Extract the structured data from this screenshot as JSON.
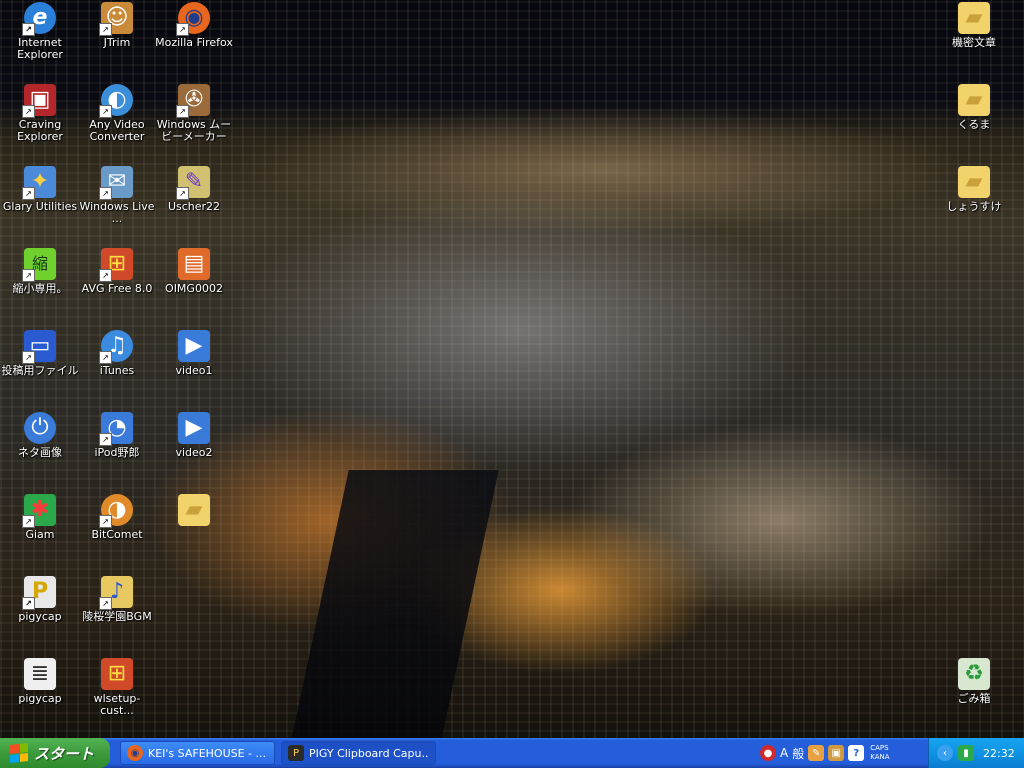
{
  "desktop_icons": [
    {
      "label": "Internet Explorer",
      "icon": "internet-explorer-icon",
      "shortcut": true,
      "color": "#2a7fd9",
      "glyph": "e"
    },
    {
      "label": "JTrim",
      "icon": "jtrim-icon",
      "shortcut": true,
      "color": "#c98a3a",
      "glyph": "☺"
    },
    {
      "label": "Mozilla Firefox",
      "icon": "firefox-icon",
      "shortcut": true,
      "color": "#e8661e",
      "glyph": "◉"
    },
    {
      "label": "Craving Explorer",
      "icon": "craving-explorer-icon",
      "shortcut": true,
      "color": "#b3262a",
      "glyph": "▣"
    },
    {
      "label": "Any Video Converter",
      "icon": "video-converter-icon",
      "shortcut": true,
      "color": "#3a8fd8",
      "glyph": "◐"
    },
    {
      "label": "Windows ムービーメーカー",
      "icon": "movie-maker-icon",
      "shortcut": true,
      "color": "#9a6a3a",
      "glyph": "✇"
    },
    {
      "label": "Glary Utilities",
      "icon": "glary-utilities-icon",
      "shortcut": true,
      "color": "#4a8ad8",
      "glyph": "✦"
    },
    {
      "label": "Windows Live ...",
      "icon": "windows-live-icon",
      "shortcut": true,
      "color": "#6a9ac8",
      "glyph": "✉"
    },
    {
      "label": "Uscher22",
      "icon": "uscher-icon",
      "shortcut": true,
      "color": "#d0c070",
      "glyph": "✎"
    },
    {
      "label": "縮小専用。",
      "icon": "shukushou-icon",
      "shortcut": true,
      "color": "#6fd02e",
      "glyph": "縮"
    },
    {
      "label": "AVG Free 8.0",
      "icon": "avg-icon",
      "shortcut": true,
      "color": "#d04a2a",
      "glyph": "⊞"
    },
    {
      "label": "OIMG0002",
      "icon": "image-file-icon",
      "shortcut": false,
      "color": "#e06a2a",
      "glyph": "▤"
    },
    {
      "label": "投稿用ファイル",
      "icon": "folder-app-icon",
      "shortcut": true,
      "color": "#2a5ad0",
      "glyph": "▭"
    },
    {
      "label": "iTunes",
      "icon": "itunes-icon",
      "shortcut": true,
      "color": "#3a8ae0",
      "glyph": "♫"
    },
    {
      "label": "video1",
      "icon": "video-file-icon",
      "shortcut": false,
      "color": "#3a7ad8",
      "glyph": "▶"
    },
    {
      "label": "ネタ画像",
      "icon": "power-icon",
      "shortcut": false,
      "color": "#3a7ad8",
      "glyph": "⏻"
    },
    {
      "label": "iPod野郎",
      "icon": "ipod-icon",
      "shortcut": true,
      "color": "#3a7ad8",
      "glyph": "◔"
    },
    {
      "label": "video2",
      "icon": "video-file-icon",
      "shortcut": false,
      "color": "#3a7ad8",
      "glyph": "▶"
    },
    {
      "label": "Giam",
      "icon": "giam-icon",
      "shortcut": true,
      "color": "#2aa84a",
      "glyph": "✱"
    },
    {
      "label": "BitComet",
      "icon": "bitcomet-icon",
      "shortcut": true,
      "color": "#e08a2a",
      "glyph": "◑"
    },
    {
      "label": "",
      "icon": "folder-icon",
      "shortcut": false,
      "color": "#f2d36b",
      "glyph": "▰"
    },
    {
      "label": "pigycap",
      "icon": "pigycap-icon",
      "shortcut": true,
      "color": "#e8e8e8",
      "glyph": "P"
    },
    {
      "label": "陵桜学園BGM",
      "icon": "music-folder-icon",
      "shortcut": true,
      "color": "#e8c860",
      "glyph": "♪"
    },
    {
      "label": "pigycap",
      "icon": "text-document-icon",
      "shortcut": false,
      "color": "#f0f0f0",
      "glyph": "≣"
    },
    {
      "label": "wlsetup-cust...",
      "icon": "windows-setup-icon",
      "shortcut": false,
      "color": "#d04a2a",
      "glyph": "⊞"
    },
    {
      "label": "機密文章",
      "icon": "folder-icon",
      "shortcut": false,
      "color": "#f2d36b",
      "glyph": "▰"
    },
    {
      "label": "くるま",
      "icon": "folder-icon",
      "shortcut": false,
      "color": "#f2d36b",
      "glyph": "▰"
    },
    {
      "label": "しょうすけ",
      "icon": "folder-icon",
      "shortcut": false,
      "color": "#f2d36b",
      "glyph": "▰"
    },
    {
      "label": "ごみ箱",
      "icon": "recycle-bin-icon",
      "shortcut": false,
      "color": "#d8e8d0",
      "glyph": "♻"
    }
  ],
  "taskbar": {
    "start_label": "スタート",
    "tasks": [
      {
        "label": "KEI's SAFEHOUSE - ...",
        "icon": "firefox-icon",
        "active": false
      },
      {
        "label": "PIGY Clipboard Capu...",
        "icon": "pigycap-icon",
        "active": true
      }
    ],
    "language_bar": {
      "ime_mode": "A",
      "input_mode": "般"
    },
    "caps": "CAPS",
    "kana": "KANA",
    "clock": "22:32"
  },
  "colors": {
    "taskbar": "#245edb",
    "start_button": "#3c9a3c",
    "notification_area": "#0d8fe0"
  }
}
